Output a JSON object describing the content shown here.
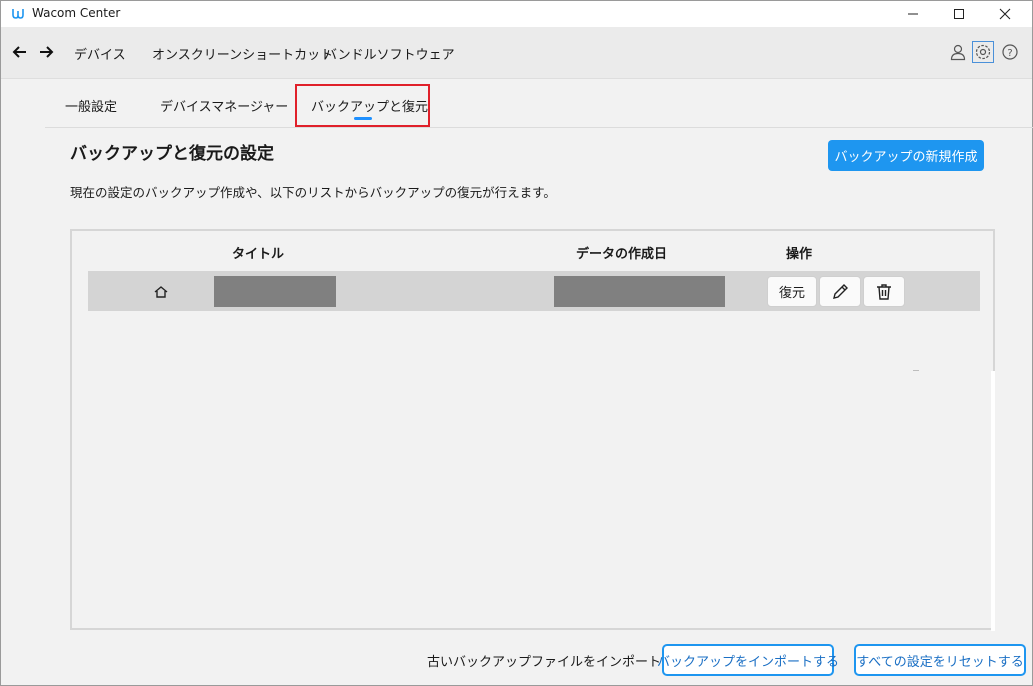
{
  "window": {
    "title": "Wacom Center"
  },
  "nav": {
    "items": [
      "デバイス",
      "オンスクリーンショートカット",
      "バンドルソフトウェア"
    ]
  },
  "tabs": [
    "一般設定",
    "デバイスマネージャー",
    "バックアップと復元"
  ],
  "active_tab": "バックアップと復元",
  "content": {
    "heading": "バックアップと復元の設定",
    "description": "現在の設定のバックアップ作成や、以下のリストからバックアップの復元が行えます。",
    "new_backup_button": "バックアップの新規作成"
  },
  "table": {
    "columns": [
      "タイトル",
      "データの作成日",
      "操作"
    ],
    "rows": [
      {
        "title": "",
        "created": "",
        "restore_label": "復元"
      }
    ]
  },
  "footer": {
    "import_label": "古いバックアップファイルをインポートする：",
    "import_button": "バックアップをインポートする",
    "reset_button": "すべての設定をリセットする"
  },
  "colors": {
    "accent": "#1e96f0",
    "highlight": "#e0202a",
    "redaction": "#808080"
  }
}
